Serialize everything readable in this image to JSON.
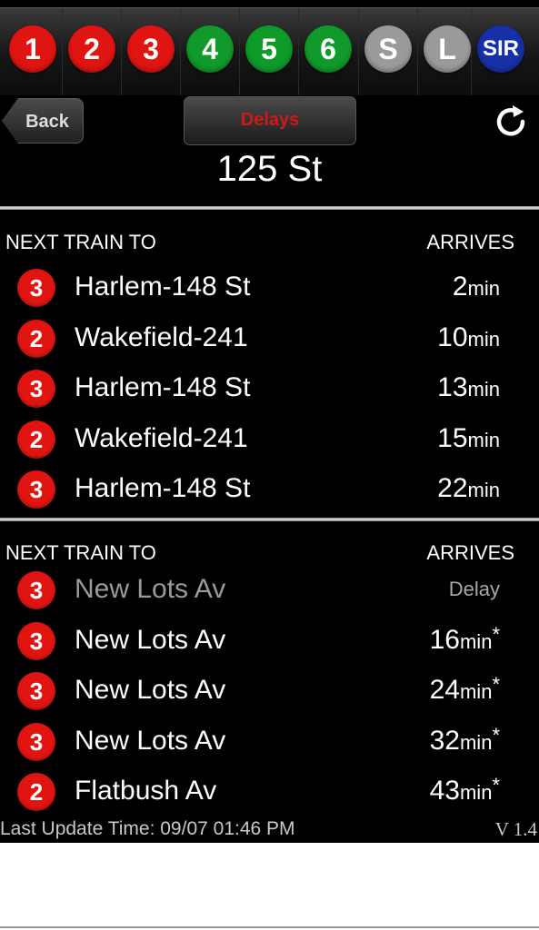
{
  "lines": [
    {
      "label": "1",
      "color": "#e01512"
    },
    {
      "label": "2",
      "color": "#e01512"
    },
    {
      "label": "3",
      "color": "#e01512"
    },
    {
      "label": "4",
      "color": "#0f9a2a"
    },
    {
      "label": "5",
      "color": "#0f9a2a"
    },
    {
      "label": "6",
      "color": "#0f9a2a"
    },
    {
      "label": "S",
      "color": "#9a9a9a"
    },
    {
      "label": "L",
      "color": "#9a9a9a"
    },
    {
      "label": "SIR",
      "color": "#1630a8"
    }
  ],
  "header": {
    "back_label": "Back",
    "delays_label": "Delays",
    "refresh_icon": "refresh-icon",
    "station": "125 St"
  },
  "uptown": {
    "col_dest": "NEXT TRAIN TO",
    "col_arrives": "ARRIVES",
    "rows": [
      {
        "line": "3",
        "dest": "Harlem-148 St",
        "time": "2",
        "unit": "min",
        "star": ""
      },
      {
        "line": "2",
        "dest": "Wakefield-241",
        "time": "10",
        "unit": "min",
        "star": ""
      },
      {
        "line": "3",
        "dest": "Harlem-148 St",
        "time": "13",
        "unit": "min",
        "star": ""
      },
      {
        "line": "2",
        "dest": "Wakefield-241",
        "time": "15",
        "unit": "min",
        "star": ""
      },
      {
        "line": "3",
        "dest": "Harlem-148 St",
        "time": "22",
        "unit": "min",
        "star": ""
      }
    ]
  },
  "downtown": {
    "col_dest": "NEXT TRAIN TO",
    "col_arrives": "ARRIVES",
    "rows": [
      {
        "line": "3",
        "dest": "New Lots Av",
        "time": "Delay",
        "unit": "",
        "star": "",
        "delayed": true
      },
      {
        "line": "3",
        "dest": "New Lots Av",
        "time": "16",
        "unit": "min",
        "star": "*"
      },
      {
        "line": "3",
        "dest": "New Lots Av",
        "time": "24",
        "unit": "min",
        "star": "*"
      },
      {
        "line": "3",
        "dest": "New Lots Av",
        "time": "32",
        "unit": "min",
        "star": "*"
      },
      {
        "line": "2",
        "dest": "Flatbush Av",
        "time": "43",
        "unit": "min",
        "star": "*"
      }
    ]
  },
  "footer": {
    "last_update": "Last Update Time: 09/07 01:46 PM",
    "version": "V 1.4"
  }
}
